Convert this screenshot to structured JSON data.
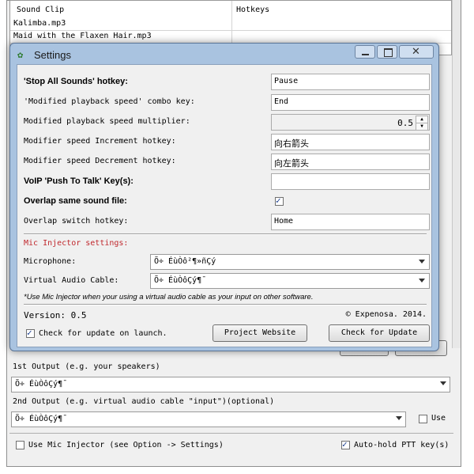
{
  "table": {
    "columns": [
      "Sound Clip",
      "Hotkeys"
    ],
    "rows": [
      "Kalimba.mp3",
      "Maid with the Flaxen Hair.mp3"
    ]
  },
  "main": {
    "output1_label": "1st Output (e.g. your speakers)",
    "output1_value": "Õ÷ ÉùÒôÇý¶¯",
    "output2_label": "2nd Output (e.g. virtual audio cable \"input\")(optional)",
    "output2_value": "Õ÷ ÉùÒôÇý¶¯",
    "use_label": "Use",
    "use_mic_injector_label": "Use Mic Injector (see Option -> Settings)",
    "auto_hold_label": "Auto-hold PTT key(s)"
  },
  "dialog": {
    "title": "Settings",
    "stop_all_label": "'Stop All Sounds' hotkey:",
    "stop_all_value": "Pause",
    "mod_speed_combo_label": "'Modified playback speed' combo key:",
    "mod_speed_combo_value": "End",
    "mod_speed_mult_label": "Modified playback speed multiplier:",
    "mod_speed_mult_value": "0.5",
    "speed_inc_label": "Modifier speed Increment hotkey:",
    "speed_inc_value": "向右箭头",
    "speed_dec_label": "Modifier speed Decrement hotkey:",
    "speed_dec_value": "向左箭头",
    "voip_label": "VoIP 'Push To Talk' Key(s):",
    "voip_value": "",
    "overlap_same_label": "Overlap same sound file:",
    "overlap_switch_label": "Overlap switch hotkey:",
    "overlap_switch_value": "Home",
    "mic_section_label": "Mic Injector settings:",
    "microphone_label": "Microphone:",
    "microphone_value": "Õ÷ ÉùÒô²¶»ñÇý",
    "vac_label": "Virtual Audio Cable:",
    "vac_value": "Õ÷ ÉùÒôÇý¶¯",
    "note": "*Use Mic Injector when your using a virtual audio cable as your input on other software.",
    "version": "Version: 0.5",
    "copyright": "© Expenosa. 2014.",
    "check_update_launch_label": "Check for update on launch.",
    "project_website_button": "Project Website",
    "check_update_button": "Check for Update"
  },
  "colors": {
    "section_red": "#c0282d",
    "title_bar": "#a9c3e0"
  }
}
